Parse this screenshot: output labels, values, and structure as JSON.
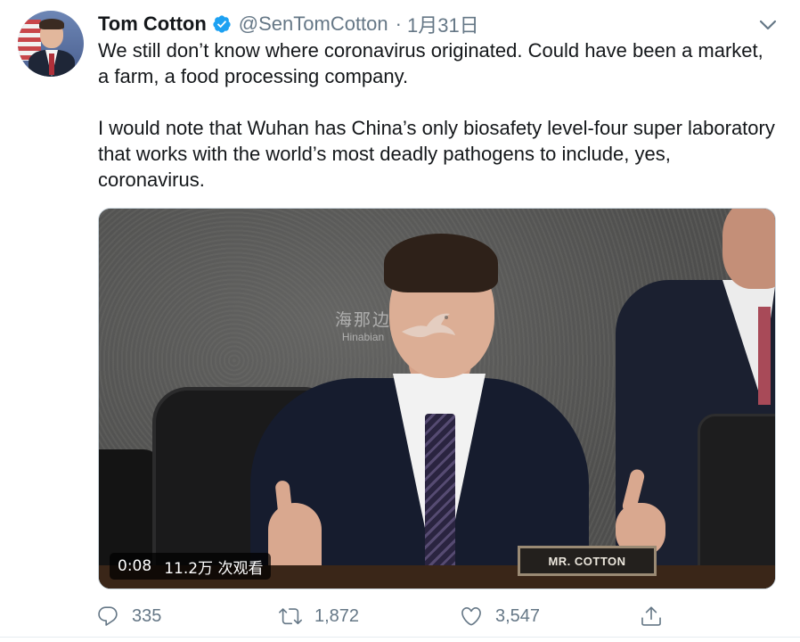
{
  "author": {
    "name": "Tom Cotton",
    "handle": "@SenTomCotton",
    "date_sep": "·",
    "date": "1月31日",
    "verified": true
  },
  "tweet": {
    "paragraphs": [
      "We still don’t know where coronavirus originated. Could have been a market, a farm, a food processing company.",
      "I would note that Wuhan has China’s only biosafety level-four super laboratory that works with the world’s most deadly pathogens to include, yes, coronavirus."
    ]
  },
  "media": {
    "duration": "0:08",
    "views": "11.2万 次观看",
    "nameplate": "MR. COTTON",
    "watermark_cn": "海那边",
    "watermark_en": "Hinabian"
  },
  "actions": {
    "reply_count": "335",
    "retweet_count": "1,872",
    "like_count": "3,547"
  },
  "colors": {
    "verified_blue": "#1da1f2",
    "secondary_text": "#657786",
    "primary_text": "#14171a"
  },
  "icons": {
    "verified": "verified-badge-icon",
    "caret": "chevron-down-icon",
    "reply": "reply-icon",
    "retweet": "retweet-icon",
    "like": "heart-icon",
    "share": "share-icon"
  }
}
